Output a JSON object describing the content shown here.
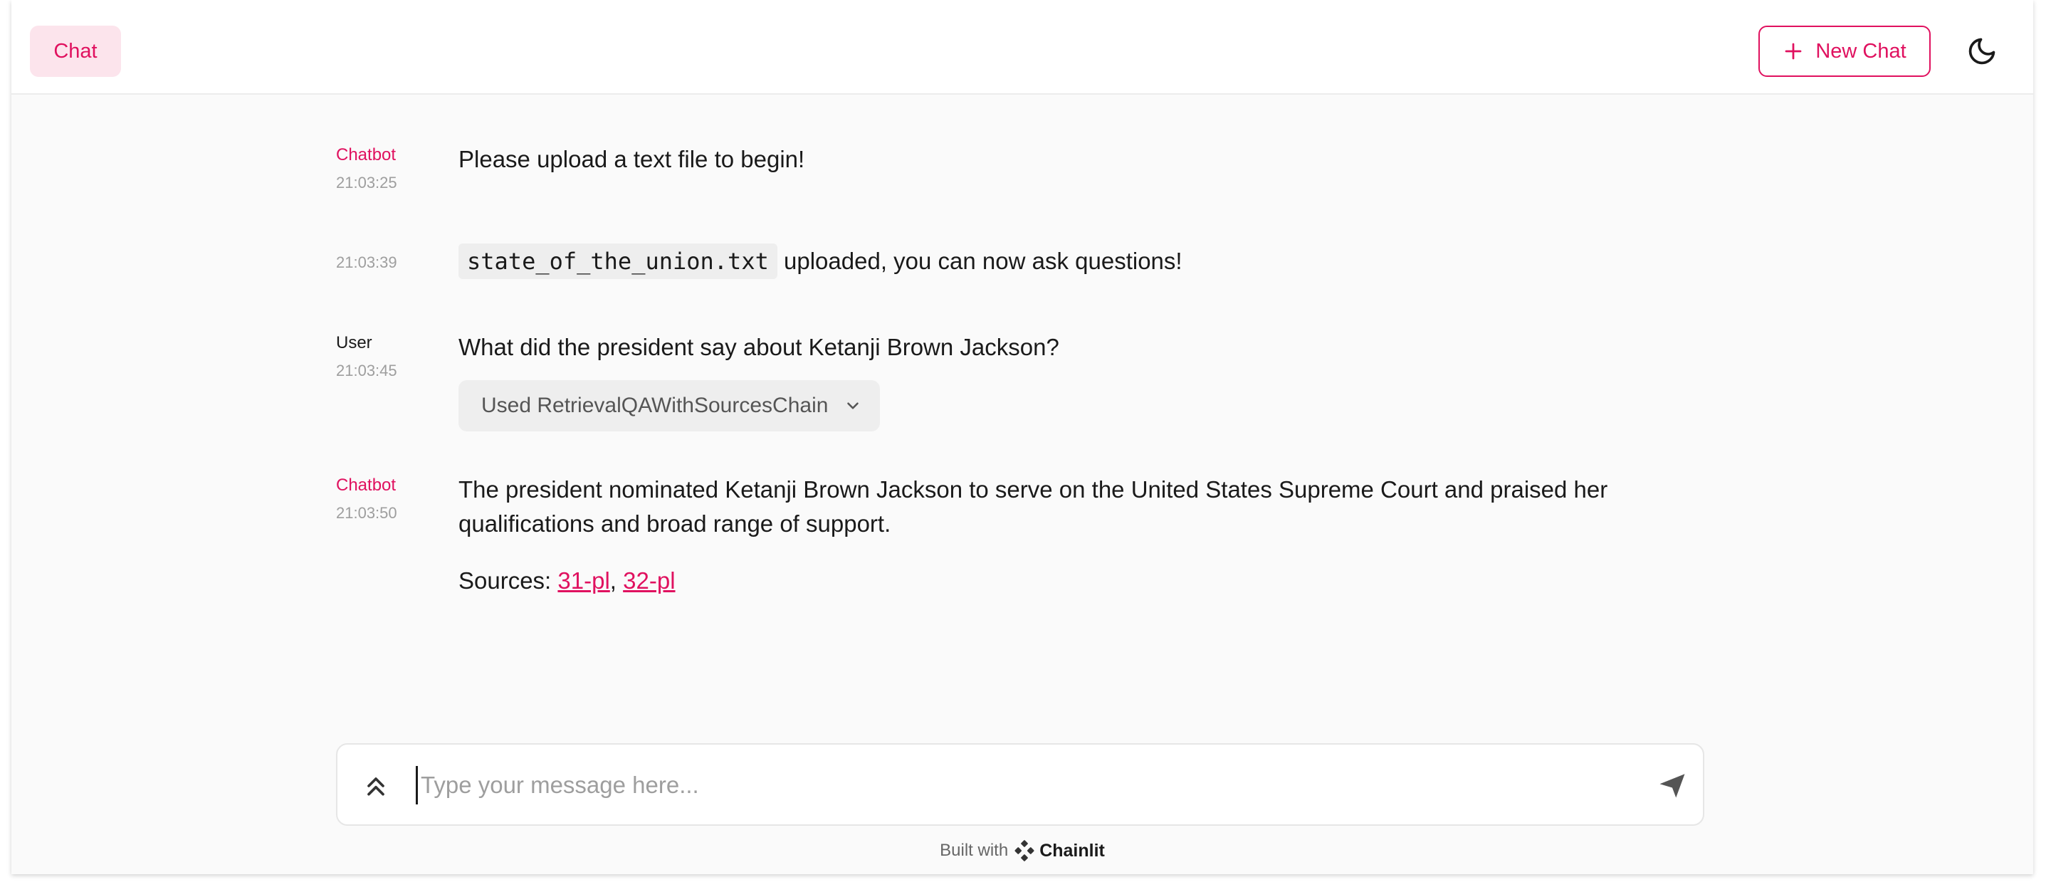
{
  "header": {
    "chat_tab": "Chat",
    "new_chat_label": "New Chat",
    "accent_color": "#e0115f"
  },
  "messages": [
    {
      "author": "Chatbot",
      "time": "21:03:25",
      "text": "Please upload a text file to begin!"
    },
    {
      "author": "",
      "time": "21:03:39",
      "file": "state_of_the_union.txt",
      "text": " uploaded, you can now ask questions!"
    },
    {
      "author": "User",
      "time": "21:03:45",
      "text": "What did the president say about Ketanji Brown Jackson?",
      "tool_label": "Used RetrievalQAWithSourcesChain"
    },
    {
      "author": "Chatbot",
      "time": "21:03:50",
      "text": "The president nominated Ketanji Brown Jackson to serve on the United States Supreme Court and praised her qualifications and broad range of support.",
      "sources_label": "Sources: ",
      "sources": [
        "31-pl",
        "32-pl"
      ],
      "sources_sep": ", "
    }
  ],
  "composer": {
    "placeholder": "Type your message here..."
  },
  "footer": {
    "built_with": "Built with",
    "brand": "Chainlit"
  }
}
